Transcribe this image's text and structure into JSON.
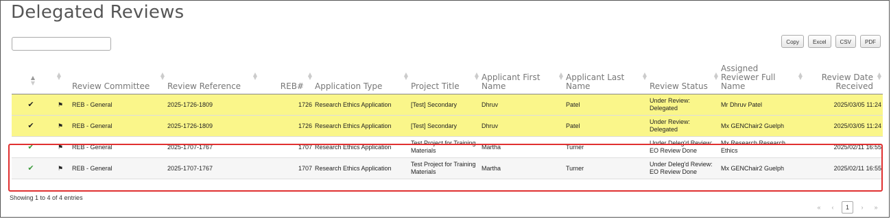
{
  "page": {
    "title": "Delegated Reviews",
    "search_value": "",
    "export_buttons": [
      "Copy",
      "Excel",
      "CSV",
      "PDF"
    ],
    "info": "Showing 1 to 4 of 4 entries",
    "pager": {
      "first": "«",
      "prev": "‹",
      "current": "1",
      "next": "›",
      "last": "»"
    }
  },
  "table": {
    "headers": [
      "",
      "",
      "Review Committee",
      "Review Reference",
      "REB#",
      "Application Type",
      "Project Title",
      "Applicant First Name",
      "Applicant Last Name",
      "Review Status",
      "Assigned Reviewer Full Name",
      "Review Date Received"
    ],
    "rows": [
      {
        "style": "hl",
        "check": "✔",
        "flag": "⚑",
        "committee": "REB - General",
        "reference": "2025-1726-1809",
        "reb": "1726",
        "app_type": "Research Ethics Application",
        "project": "[Test] Secondary",
        "first": "Dhruv",
        "last": "Patel",
        "status": "Under Review: Delegated",
        "reviewer": "Mr Dhruv Patel",
        "date": "2025/03/05 11:24"
      },
      {
        "style": "hl",
        "check": "✔",
        "flag": "⚑",
        "committee": "REB - General",
        "reference": "2025-1726-1809",
        "reb": "1726",
        "app_type": "Research Ethics Application",
        "project": "[Test] Secondary",
        "first": "Dhruv",
        "last": "Patel",
        "status": "Under Review: Delegated",
        "reviewer": "Mx GENChair2 Guelph",
        "date": "2025/03/05 11:24"
      },
      {
        "style": "plain",
        "check": "✔",
        "flag": "⚑",
        "committee": "REB - General",
        "reference": "2025-1707-1767",
        "reb": "1707",
        "app_type": "Research Ethics Application",
        "project": "Test Project for Training Materials",
        "first": "Martha",
        "last": "Turner",
        "status": "Under Deleg'd Review: EO Review Done",
        "reviewer": "Mx Research Research Ethics",
        "date": "2025/02/11 16:55"
      },
      {
        "style": "g",
        "check": "✔",
        "flag": "⚑",
        "committee": "REB - General",
        "reference": "2025-1707-1767",
        "reb": "1707",
        "app_type": "Research Ethics Application",
        "project": "Test Project for Training Materials",
        "first": "Martha",
        "last": "Turner",
        "status": "Under Deleg'd Review: EO Review Done",
        "reviewer": "Mx GENChair2 Guelph",
        "date": "2025/02/11 16:55"
      }
    ]
  }
}
